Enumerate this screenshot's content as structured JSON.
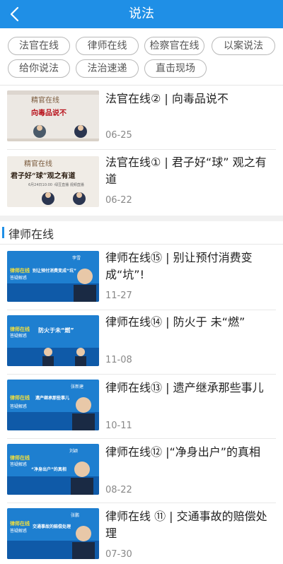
{
  "header": {
    "title": "说法"
  },
  "tags": [
    "法官在线",
    "律师在线",
    "检察官在线",
    "以案说法",
    "给你说法",
    "法治速递",
    "直击现场"
  ],
  "section": {
    "title": "律师在线"
  },
  "thumbs": {
    "judge_brand": "精官在线",
    "judge_topic_1": "向毒品说不",
    "judge_topic_2": "君子好“球”观之有道",
    "judge_sub_2": "6月24日10:00 ·绿豆直播 视频直播",
    "lawyer_brand": "律师在线",
    "lawyer_sub": "答疑解惑",
    "lawyer_topic_15": "别让预付消费变成“坑”",
    "lawyer_topic_14": "防火于未“燃”",
    "lawyer_topic_13": "遗产继承那些事儿",
    "lawyer_topic_12": "“净身出户”的真相",
    "lawyer_topic_11": "交通事故的赔偿处理",
    "lawyer_name_15": "李雪",
    "lawyer_name_13": "张新建",
    "lawyer_name_12": "刘颖",
    "lawyer_name_11": "张鹏"
  },
  "items": [
    {
      "title": "法官在线② | 向毒品说不",
      "date": "06-25"
    },
    {
      "title": "法官在线① | 君子好“球” 观之有道",
      "date": "06-22"
    },
    {
      "title": "律师在线⑮ | 别让预付消费变成“坑”!",
      "date": "11-27"
    },
    {
      "title": "律师在线⑭ | 防火于 未“燃”",
      "date": "11-08"
    },
    {
      "title": "律师在线⑬ | 遗产继承那些事儿",
      "date": "10-11"
    },
    {
      "title": "律师在线⑫ |“净身出户”的真相",
      "date": "08-22"
    },
    {
      "title": "律师在线 ⑪ | 交通事故的赔偿处理",
      "date": "07-30"
    }
  ],
  "colors": {
    "brand_blue": "#1f8fe6",
    "judge_red": "#b8101a"
  },
  "icons": {
    "back": "chevron-left-icon"
  }
}
